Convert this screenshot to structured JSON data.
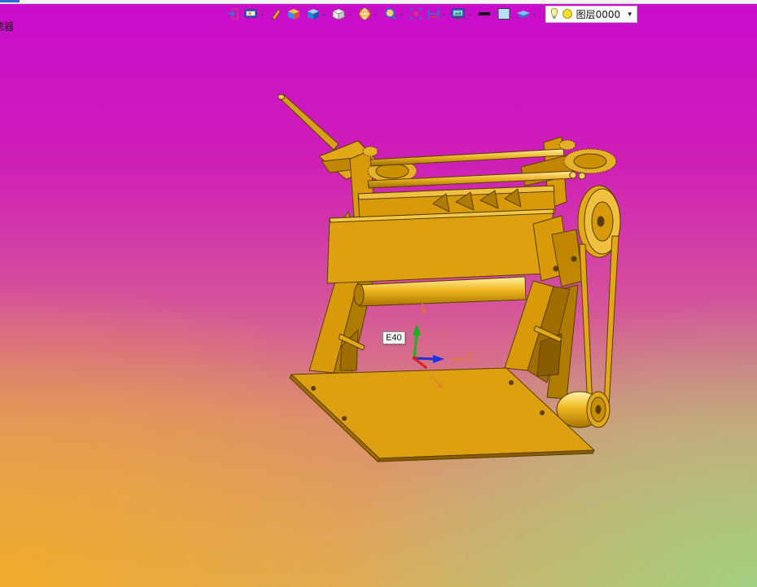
{
  "window": {
    "side_label": "滤器"
  },
  "toolbar": {
    "buttons": [
      {
        "icon": "exit-icon",
        "has_dropdown": false
      },
      {
        "icon": "view-monitor-icon",
        "has_dropdown": true
      },
      {
        "icon": "pen-sketch-icon",
        "has_dropdown": false
      },
      {
        "icon": "box-colored-icon",
        "has_dropdown": false
      },
      {
        "icon": "cube-blue-icon",
        "has_dropdown": true
      },
      {
        "icon": "cube-white-icon",
        "has_dropdown": true
      },
      {
        "icon": "sphere-orange-icon",
        "has_dropdown": true
      },
      {
        "icon": "zoom-icon",
        "has_dropdown": true
      },
      {
        "icon": "fit-view-icon",
        "has_dropdown": false
      },
      {
        "icon": "section-icon",
        "has_dropdown": true
      },
      {
        "icon": "display-screen-icon",
        "has_dropdown": true
      },
      {
        "icon": "line-black-icon",
        "has_dropdown": false
      },
      {
        "icon": "color-swatch-icon",
        "has_dropdown": false
      },
      {
        "icon": "layers-icon",
        "has_dropdown": true
      }
    ],
    "layer": {
      "name": "图层0000",
      "bulb_icon": "lightbulb-icon",
      "color_icon": "layer-color-dot-icon"
    }
  },
  "viewport": {
    "triad_label": "E40",
    "axis_label_z": "Z",
    "colors": {
      "bg_top": "#c80ccc",
      "bg_bottom_left": "#f0aa28",
      "bg_bottom_right": "#a0d282",
      "model": "#d99a0a",
      "model_dark": "#a06e00",
      "model_light": "#f0c040"
    }
  }
}
